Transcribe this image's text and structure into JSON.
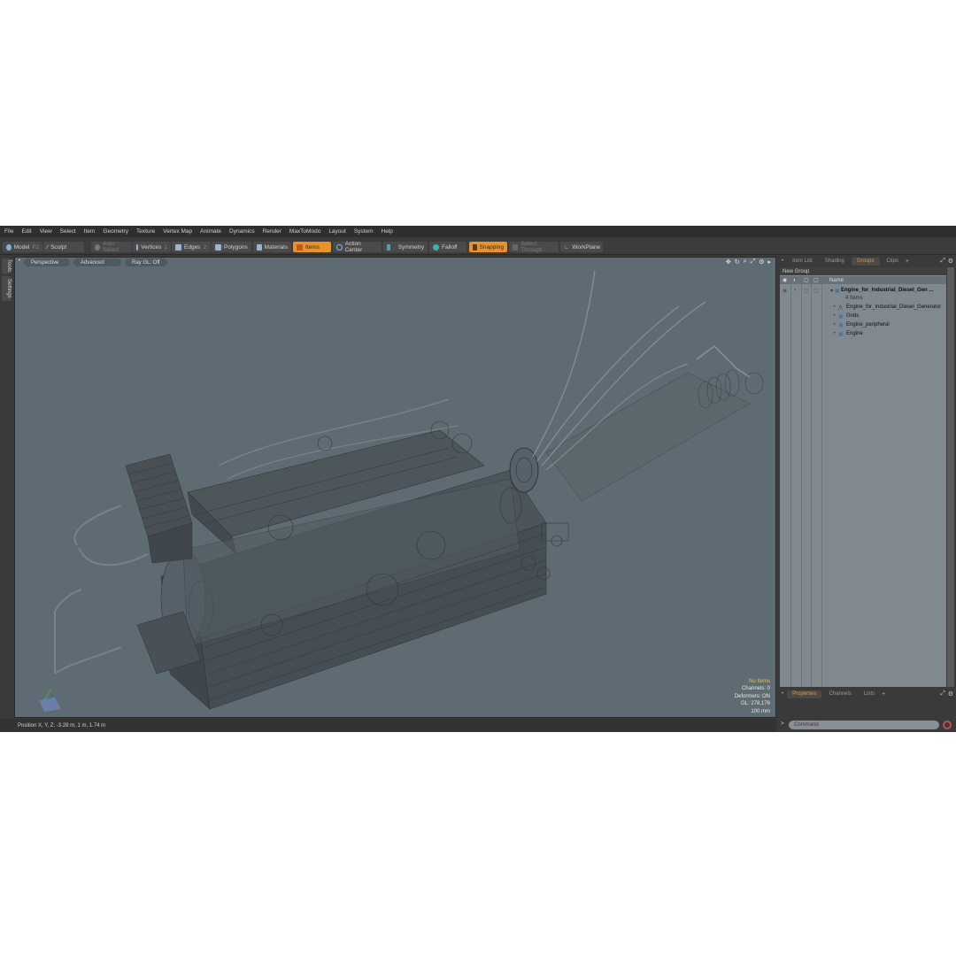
{
  "menu": [
    "File",
    "Edit",
    "View",
    "Select",
    "Item",
    "Geometry",
    "Texture",
    "Vertex Map",
    "Animate",
    "Dynamics",
    "Render",
    "MaxToModo",
    "Layout",
    "System",
    "Help"
  ],
  "toolbar": {
    "model": "Model",
    "model_key": "F2",
    "sculpt": "Sculpt",
    "auto_select": "Auto Select",
    "vertices": "Vertices",
    "vertices_key": "1",
    "edges": "Edges",
    "edges_key": "2",
    "polygons": "Polygons",
    "materials": "Materials",
    "items": "Items",
    "action_center": "Action Center",
    "symmetry": "Symmetry",
    "falloff": "Falloff",
    "snapping": "Snapping",
    "select_through": "Select Through",
    "workplane": "WorkPlane"
  },
  "left_tabs": [
    "Tools",
    "Settings"
  ],
  "viewport": {
    "view": "Perspective",
    "mode": "Advanced",
    "raygl": "Ray GL: Off",
    "info": {
      "items": "No Items",
      "channels": "Channels: 0",
      "deformers": "Deformers: ON",
      "gl": "GL: 278,176",
      "scale": "100 mm"
    }
  },
  "status": {
    "position": "Position X, Y, Z:   -3.28 m,  1 m,  1.74 m"
  },
  "right_panel": {
    "tabs": [
      "Item List",
      "Shading",
      "Groups",
      "Clips"
    ],
    "active_tab": "Groups",
    "new_group": "New Group",
    "col_name": "Name",
    "tree": {
      "root": "Engine_for_Industrial_Diesel_Gen ...",
      "root_count": "4 Items",
      "children": [
        "Engine_for_Industrial_Diesel_Generator",
        "Grids",
        "Engine_peripheral",
        "Engine"
      ]
    },
    "bottom_tabs": [
      "Properties",
      "Channels",
      "Lists"
    ],
    "bottom_active": "Properties",
    "command_placeholder": "Command"
  },
  "colors": {
    "accent": "#e8922b",
    "viewport_bg": "#5f6b72",
    "panel_bg": "#3a3a3a"
  }
}
